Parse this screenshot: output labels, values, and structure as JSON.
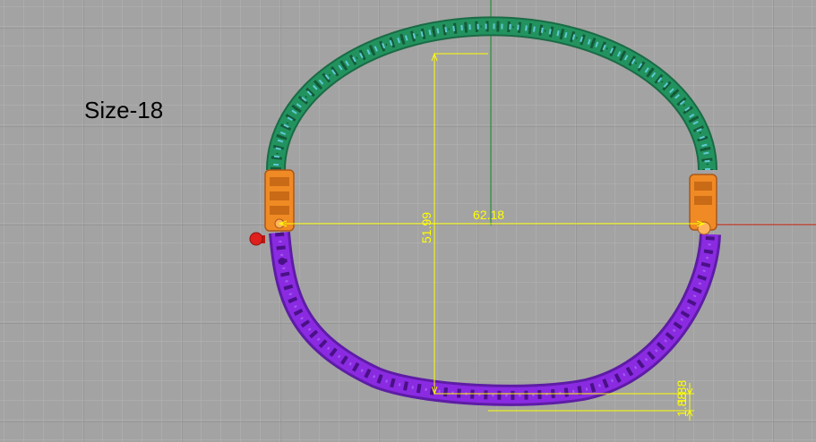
{
  "viewport": {
    "background": "#a3a3a3",
    "grid_minor_color": "#b3b3b3",
    "grid_major_color": "#8c8c8c",
    "axis_x_color": "#c0392b",
    "axis_y_color": "#2e8b3a"
  },
  "label": {
    "size_text": "Size-18"
  },
  "bangle": {
    "upper_color": "#1e8a5a",
    "stone_color": "#5fc9d6",
    "hinge_color": "#f08a24",
    "lower_color": "#8a2be2",
    "clasp_color": "#e0201c"
  },
  "dimensions": {
    "color": "#ffff00",
    "width": "62.18",
    "height": "51.99",
    "thickness": "1.88"
  }
}
